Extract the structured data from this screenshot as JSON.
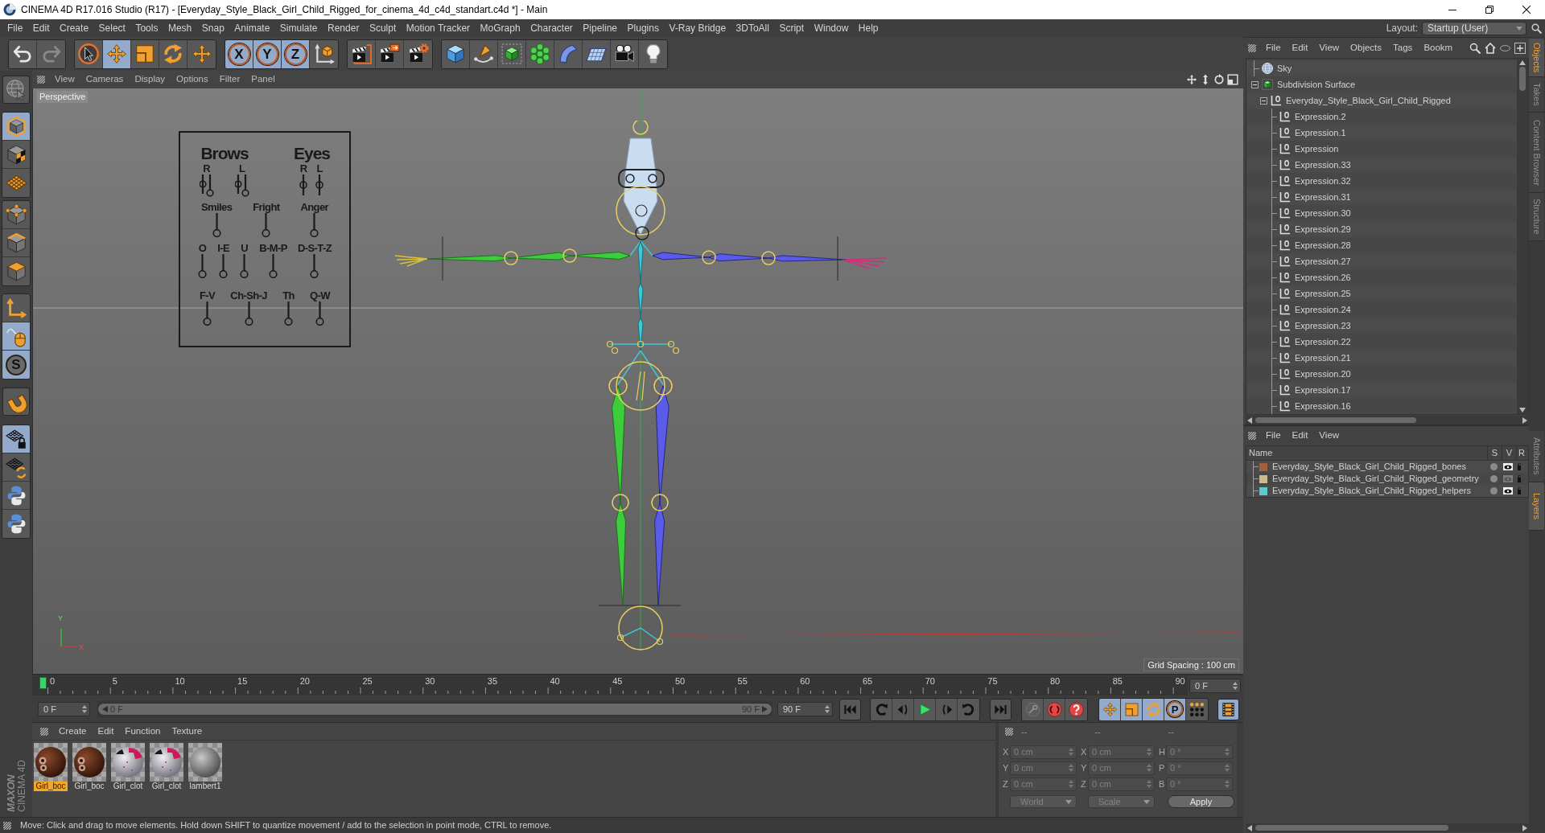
{
  "window": {
    "title": "CINEMA 4D R17.016 Studio (R17) - [Everyday_Style_Black_Girl_Child_Rigged_for_cinema_4d_c4d_standart.c4d *] - Main"
  },
  "menu_bar": {
    "items": [
      "File",
      "Edit",
      "Create",
      "Select",
      "Tools",
      "Mesh",
      "Snap",
      "Animate",
      "Simulate",
      "Render",
      "Sculpt",
      "Motion Tracker",
      "MoGraph",
      "Character",
      "Pipeline",
      "Plugins",
      "V-Ray Bridge",
      "3DToAll",
      "Script",
      "Window",
      "Help"
    ],
    "layout_label": "Layout:",
    "layout_value": "Startup (User)"
  },
  "toolbar": {
    "groups": [
      [
        {
          "kind": "undo",
          "selected": false,
          "disabled": false
        },
        {
          "kind": "redo",
          "selected": false,
          "disabled": true
        }
      ],
      [
        {
          "kind": "live-select",
          "selected": false,
          "disabled": false
        },
        {
          "kind": "move",
          "selected": true,
          "disabled": false
        },
        {
          "kind": "scale",
          "selected": false,
          "disabled": false
        },
        {
          "kind": "rotate",
          "selected": false,
          "disabled": false
        },
        {
          "kind": "recent-move",
          "selected": false,
          "disabled": false
        }
      ],
      [
        {
          "kind": "axis-lock",
          "label": "X",
          "selected": true,
          "disabled": false
        },
        {
          "kind": "axis-lock",
          "label": "Y",
          "selected": true,
          "disabled": false
        },
        {
          "kind": "axis-lock",
          "label": "Z",
          "selected": true,
          "disabled": false
        },
        {
          "kind": "coordinate-system",
          "selected": false,
          "disabled": false
        }
      ],
      [
        {
          "kind": "render-view",
          "selected": false,
          "disabled": false
        },
        {
          "kind": "render",
          "selected": false,
          "disabled": false
        },
        {
          "kind": "render-settings",
          "selected": false,
          "disabled": false
        }
      ],
      [
        {
          "kind": "cube",
          "selected": false,
          "disabled": false
        },
        {
          "kind": "pen",
          "selected": false,
          "disabled": false
        },
        {
          "kind": "subdivision",
          "selected": false,
          "disabled": false
        },
        {
          "kind": "cloner",
          "selected": false,
          "disabled": false
        },
        {
          "kind": "bend",
          "selected": false,
          "disabled": false
        },
        {
          "kind": "floor",
          "selected": false,
          "disabled": false
        },
        {
          "kind": "camera",
          "selected": false,
          "disabled": false
        },
        {
          "kind": "light",
          "selected": false,
          "disabled": false
        }
      ]
    ]
  },
  "tools": {
    "groups": [
      [
        {
          "kind": "globe-cursor",
          "selected": false
        }
      ],
      [
        {
          "kind": "model",
          "selected": true
        },
        {
          "kind": "texture",
          "selected": false
        },
        {
          "kind": "workplane",
          "selected": false
        }
      ],
      [
        {
          "kind": "points",
          "selected": false
        },
        {
          "kind": "edges",
          "selected": false
        },
        {
          "kind": "polygons",
          "selected": false
        }
      ],
      [
        {
          "kind": "object-axis",
          "selected": false
        },
        {
          "kind": "tweak",
          "selected": true
        },
        {
          "kind": "soft-selection",
          "label": "S",
          "selected": true
        }
      ],
      [
        {
          "kind": "magnet",
          "selected": false
        }
      ],
      [
        {
          "kind": "grid-lock",
          "selected": true
        },
        {
          "kind": "grid-rotate",
          "selected": false
        },
        {
          "kind": "python",
          "selected": false
        },
        {
          "kind": "python",
          "selected": false
        }
      ]
    ]
  },
  "logo": {
    "brand": "MAXON",
    "product": "CINEMA 4D"
  },
  "viewport": {
    "menu": [
      "View",
      "Cameras",
      "Display",
      "Options",
      "Filter",
      "Panel"
    ],
    "camera": "Perspective",
    "grid_spacing": "Grid Spacing : 100 cm",
    "axis_labels": [
      "Y",
      "X"
    ],
    "face_panel": {
      "groups": [
        {
          "label": "Brows",
          "kind": "pair",
          "controls": [
            "R",
            "L"
          ]
        },
        {
          "label": "Eyes",
          "kind": "single",
          "controls": [
            "R",
            "L"
          ]
        }
      ],
      "rows": [
        {
          "controls": [
            "Smiles",
            "Fright",
            "Anger"
          ]
        },
        {
          "controls": [
            "O",
            "I-E",
            "U",
            "B-M-P",
            "D-S-T-Z"
          ]
        },
        {
          "controls": [
            "F-V",
            "Ch-Sh-J",
            "Th",
            "Q-W"
          ]
        }
      ]
    }
  },
  "timeline": {
    "ticks": [
      "0",
      "5",
      "10",
      "15",
      "20",
      "25",
      "30",
      "35",
      "40",
      "45",
      "50",
      "55",
      "60",
      "65",
      "70",
      "75",
      "80",
      "85",
      "90"
    ],
    "playhead": {
      "level": 0
    },
    "current_frame": "0 F",
    "start_frame": "0 F",
    "range_slider": {
      "level": 1,
      "start": "0 F",
      "end": "90 F"
    },
    "end_frame": "90 F"
  },
  "transport": {
    "groups": [
      [
        {
          "kind": "go-start",
          "selected": false
        }
      ],
      [
        {
          "kind": "loop-back",
          "selected": false
        },
        {
          "kind": "step-back",
          "selected": false
        },
        {
          "kind": "play",
          "selected": false
        },
        {
          "kind": "step-forward",
          "selected": false
        },
        {
          "kind": "loop-forward",
          "selected": false
        }
      ],
      [
        {
          "kind": "go-end",
          "selected": false
        }
      ],
      [
        {
          "kind": "key",
          "selected": false
        },
        {
          "kind": "record",
          "selected": false
        },
        {
          "kind": "autokey",
          "selected": false
        }
      ],
      [
        {
          "kind": "move",
          "selected": true
        },
        {
          "kind": "scale",
          "selected": true
        },
        {
          "kind": "rotate",
          "selected": true
        },
        {
          "kind": "parameter",
          "label": "P",
          "selected": true
        },
        {
          "kind": "point-level",
          "selected": false
        }
      ],
      [
        {
          "kind": "timeline",
          "selected": true
        }
      ]
    ]
  },
  "materials": {
    "menu": [
      "Create",
      "Edit",
      "Function",
      "Texture"
    ],
    "items": [
      {
        "name": "Girl_boc",
        "kind": "skin",
        "selected": true
      },
      {
        "name": "Girl_boc",
        "kind": "skin",
        "selected": false
      },
      {
        "name": "Girl_clot",
        "kind": "cloth",
        "selected": false
      },
      {
        "name": "Girl_clot",
        "kind": "cloth",
        "selected": false
      },
      {
        "name": "lambert1",
        "kind": "plain",
        "selected": false
      }
    ]
  },
  "coordinates": {
    "headers": [
      "--",
      "--",
      "--"
    ],
    "rows": [
      [
        {
          "label": "X",
          "value": "0 cm"
        },
        {
          "label": "X",
          "value": "0 cm"
        },
        {
          "label": "H",
          "value": "0 °"
        }
      ],
      [
        {
          "label": "Y",
          "value": "0 cm"
        },
        {
          "label": "Y",
          "value": "0 cm"
        },
        {
          "label": "P",
          "value": "0 °"
        }
      ],
      [
        {
          "label": "Z",
          "value": "0 cm"
        },
        {
          "label": "Z",
          "value": "0 cm"
        },
        {
          "label": "B",
          "value": "0 °"
        }
      ]
    ],
    "dropdowns": [
      "World",
      "Scale"
    ],
    "apply": "Apply"
  },
  "status_bar": {
    "text": "Move: Click and drag to move elements. Hold down SHIFT to quantize movement / add to the selection in point mode, CTRL to remove."
  },
  "object_manager": {
    "menu": [
      "File",
      "Edit",
      "View",
      "Objects",
      "Tags",
      "Bookm"
    ],
    "tree": [
      {
        "name": "Sky",
        "kind": "sky"
      },
      {
        "name": "Subdivision Surface",
        "kind": "subdivision",
        "expanded": true,
        "children": [
          {
            "name": "Everyday_Style_Black_Girl_Child_Rigged",
            "kind": "null",
            "expanded": true,
            "children": [
              {
                "name": "Expression.2",
                "kind": "null"
              },
              {
                "name": "Expression.1",
                "kind": "null"
              },
              {
                "name": "Expression",
                "kind": "null"
              },
              {
                "name": "Expression.33",
                "kind": "null"
              },
              {
                "name": "Expression.32",
                "kind": "null"
              },
              {
                "name": "Expression.31",
                "kind": "null"
              },
              {
                "name": "Expression.30",
                "kind": "null"
              },
              {
                "name": "Expression.29",
                "kind": "null"
              },
              {
                "name": "Expression.28",
                "kind": "null"
              },
              {
                "name": "Expression.27",
                "kind": "null"
              },
              {
                "name": "Expression.26",
                "kind": "null"
              },
              {
                "name": "Expression.25",
                "kind": "null"
              },
              {
                "name": "Expression.24",
                "kind": "null"
              },
              {
                "name": "Expression.23",
                "kind": "null"
              },
              {
                "name": "Expression.22",
                "kind": "null"
              },
              {
                "name": "Expression.21",
                "kind": "null"
              },
              {
                "name": "Expression.20",
                "kind": "null"
              },
              {
                "name": "Expression.17",
                "kind": "null"
              },
              {
                "name": "Expression.16",
                "kind": "null"
              }
            ]
          }
        ]
      }
    ]
  },
  "layer_manager": {
    "menu": [
      "File",
      "Edit",
      "View"
    ],
    "columns": [
      "Name",
      "S",
      "V",
      "R"
    ],
    "layers": [
      {
        "name": "Everyday_Style_Black_Girl_Child_Rigged_bones",
        "color": "#a2603e",
        "visible": true
      },
      {
        "name": "Everyday_Style_Black_Girl_Child_Rigged_geometry",
        "color": "#cdb98e",
        "visible": false
      },
      {
        "name": "Everyday_Style_Black_Girl_Child_Rigged_helpers",
        "color": "#5ccaca",
        "visible": true
      }
    ]
  },
  "side_tabs": {
    "top": [
      {
        "label": "Objects",
        "selected": true
      },
      {
        "label": "Takes",
        "selected": false
      },
      {
        "label": "Content Browser",
        "selected": false
      },
      {
        "label": "Structure",
        "selected": false
      }
    ],
    "bottom": [
      {
        "label": "Attributes",
        "selected": false
      },
      {
        "label": "Layers",
        "selected": true
      }
    ]
  }
}
